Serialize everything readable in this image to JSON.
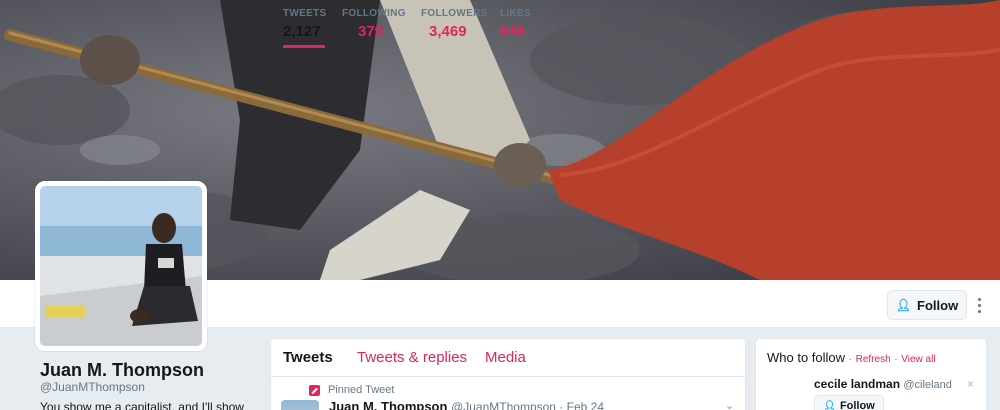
{
  "profile": {
    "name": "Juan M. Thompson",
    "handle": "@JuanMThompson",
    "bio": "You show me a capitalist, and I'll show"
  },
  "stats": [
    {
      "label": "TWEETS",
      "value": "2,127"
    },
    {
      "label": "FOLLOWING",
      "value": "379"
    },
    {
      "label": "FOLLOWERS",
      "value": "3,469"
    },
    {
      "label": "LIKES",
      "value": "648"
    }
  ],
  "actions": {
    "follow_label": "Follow"
  },
  "tabs": [
    {
      "label": "Tweets"
    },
    {
      "label": "Tweets & replies"
    },
    {
      "label": "Media"
    }
  ],
  "pinned": {
    "label": "Pinned Tweet",
    "author": "Juan M. Thompson",
    "handle_date": "@JuanMThompson · Feb 24"
  },
  "who_to_follow": {
    "title": "Who to follow",
    "separator": "·",
    "refresh": "Refresh",
    "view_all": "View all",
    "suggestion": {
      "name": "cecile landman",
      "handle": "@cileland",
      "follow_label": "Follow",
      "close": "×"
    }
  },
  "colors": {
    "accent": "#e0245e",
    "link_blue": "#1da1f2"
  },
  "icons": [
    "follow-person-icon",
    "more-options-icon",
    "pin-icon",
    "chevron-down-icon",
    "close-icon"
  ]
}
